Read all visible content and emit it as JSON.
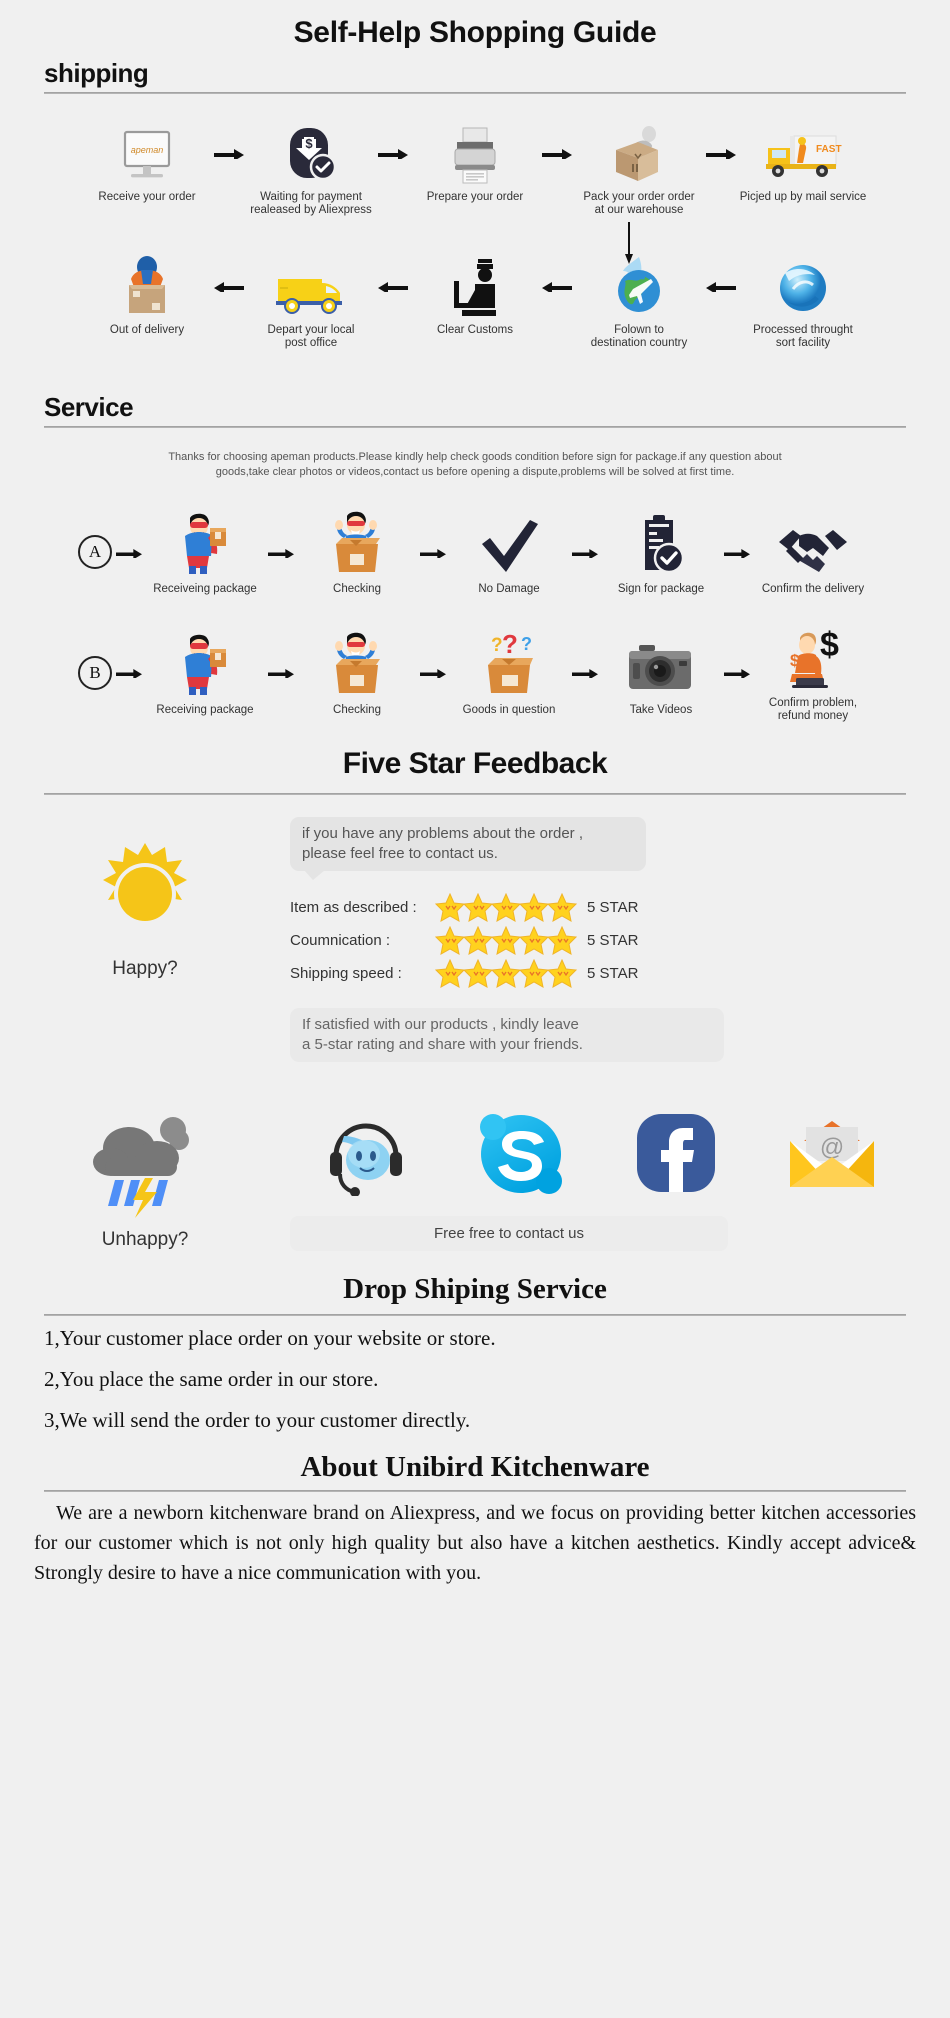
{
  "header": {
    "main_title": "Self-Help Shopping Guide"
  },
  "shipping": {
    "section_title": "shipping",
    "row1": [
      {
        "icon": "monitor-apeman-icon",
        "label": "Receive your order"
      },
      {
        "icon": "payment-shield-dollar-icon",
        "label": "Waiting for payment\nrealeased by Aliexpress"
      },
      {
        "icon": "printer-icon",
        "label": "Prepare your order"
      },
      {
        "icon": "worker-packing-box-icon",
        "label": "Pack your order order\nat our warehouse"
      },
      {
        "icon": "fast-delivery-truck-icon",
        "label": "Picjed up by mail service"
      }
    ],
    "row2": [
      {
        "icon": "courier-carrying-box-icon",
        "label": "Out of delivery"
      },
      {
        "icon": "yellow-van-icon",
        "label": "Depart your local\npost office"
      },
      {
        "icon": "customs-officer-icon",
        "label": "Clear Customs"
      },
      {
        "icon": "globe-airplane-icon",
        "label": "Folown to\ndestination country"
      },
      {
        "icon": "blue-sphere-sort-icon",
        "label": "Processed throught\nsort facility"
      }
    ]
  },
  "service": {
    "section_title": "Service",
    "paragraph_line1": "Thanks for choosing apeman products.Please kindly help check goods condition before sign for package.if any question about",
    "paragraph_line2": "goods,take clear photos or videos,contact us before opening a dispute,problems will be solved at first time.",
    "rowA": {
      "badge": "A",
      "steps": [
        {
          "icon": "hero-holding-package-icon",
          "label": "Receiveing package"
        },
        {
          "icon": "hero-in-open-box-icon",
          "label": "Checking"
        },
        {
          "icon": "checkmark-icon",
          "label": "No Damage"
        },
        {
          "icon": "clipboard-check-icon",
          "label": "Sign for package"
        },
        {
          "icon": "handshake-icon",
          "label": "Confirm the delivery"
        }
      ]
    },
    "rowB": {
      "badge": "B",
      "steps": [
        {
          "icon": "hero-holding-package-icon",
          "label": "Receiving package"
        },
        {
          "icon": "hero-in-open-box-icon",
          "label": "Checking"
        },
        {
          "icon": "box-question-marks-icon",
          "label": "Goods in question"
        },
        {
          "icon": "camera-icon",
          "label": "Take Videos"
        },
        {
          "icon": "agent-dollar-icon",
          "label": "Confirm problem,\nrefund money"
        }
      ]
    }
  },
  "feedback": {
    "title": "Five Star Feedback",
    "bubble_top_line1": "if you have any problems about the order ,",
    "bubble_top_line2": "please feel free to contact us.",
    "ratings": [
      {
        "label": "Item as described :",
        "stars": 5,
        "value": "5 STAR"
      },
      {
        "label": "Coumnication :",
        "stars": 5,
        "value": "5 STAR"
      },
      {
        "label": "Shipping speed :",
        "stars": 5,
        "value": "5 STAR"
      }
    ],
    "bubble_bottom_line1": "If satisfied with our products ,  kindly leave",
    "bubble_bottom_line2": "a 5-star rating and share with your friends.",
    "happy_label": "Happy?",
    "unhappy_label": "Unhappy?",
    "contact_button": "Free free to contact us",
    "contact_icons": [
      {
        "icon": "trademanager-headset-icon"
      },
      {
        "icon": "skype-icon"
      },
      {
        "icon": "facebook-icon"
      },
      {
        "icon": "email-envelope-icon"
      }
    ],
    "star_color": "#FFD21E"
  },
  "dropshipping": {
    "title": "Drop Shiping Service",
    "lines": [
      "1,Your customer place order on your website or store.",
      "2,You place the same order in our store.",
      "3,We will send the order to your customer directly."
    ]
  },
  "about": {
    "title": "About Unibird Kitchenware",
    "paragraph": "We are a newborn kitchenware brand on Aliexpress, and we focus on providing better kitchen accessories for our customer which is not only high quality but also have a kitchen aesthetics. Kindly accept advice& Strongly desire to have a nice communication with you."
  }
}
